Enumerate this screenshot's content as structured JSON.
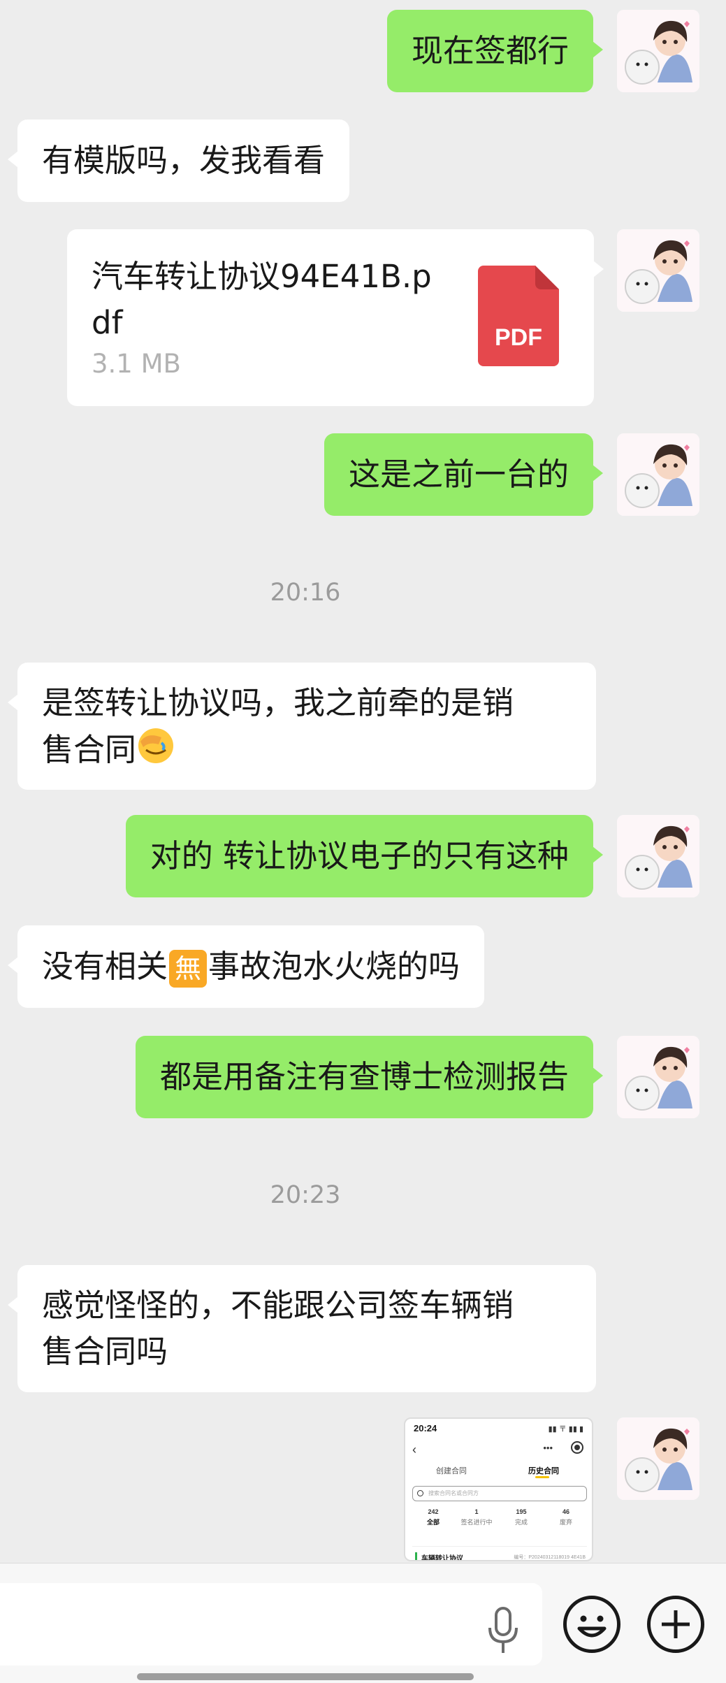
{
  "messages": [
    {
      "side": "out",
      "text": "现在签都行"
    },
    {
      "side": "in",
      "text": "有模版吗，发我看看"
    },
    {
      "side": "out",
      "type": "file",
      "file_name": "汽车转让协议94E41B.pdf",
      "file_size": "3.1 MB",
      "file_icon_label": "PDF"
    },
    {
      "side": "out",
      "text": "这是之前一台的"
    },
    {
      "time": "20:16"
    },
    {
      "side": "in",
      "text_line1": "是签转让协议吗，我之前牵的是销",
      "text_line2": "售合同",
      "emoji": "facepalm-emoji"
    },
    {
      "side": "out",
      "text": "对的 转让协议电子的只有这种"
    },
    {
      "side": "in",
      "text_before": "没有相关",
      "emoji_char": "無",
      "text_after": "事故泡水火烧的吗"
    },
    {
      "side": "out",
      "text": "都是用备注有查博士检测报告"
    },
    {
      "time": "20:23"
    },
    {
      "side": "in",
      "text_line1": "感觉怪怪的，不能跟公司签车辆销",
      "text_line2": "售合同吗"
    },
    {
      "side": "out",
      "type": "image"
    }
  ],
  "screenshot_thumb": {
    "status_time": "20:24",
    "status_right": "▮▮ 〒 ▮▮ ▮",
    "back_glyph": "‹",
    "menu_glyph": "•••",
    "tab_create": "创建合同",
    "tab_history": "历史合同",
    "search_placeholder": "搜索合同名或合同方",
    "stats": [
      {
        "num": "242",
        "label": "全部"
      },
      {
        "num": "1",
        "label": "签名进行中"
      },
      {
        "num": "195",
        "label": "完成"
      },
      {
        "num": "46",
        "label": "废弃"
      }
    ],
    "card_title": "车辆转让协议",
    "card_no": "编号：P20240312118019 4E41B"
  },
  "colors": {
    "background": "#ededed",
    "outgoing_bubble": "#95ec69",
    "incoming_bubble": "#ffffff",
    "pdf_red": "#e5484d",
    "timestamp": "#9b9b9b"
  },
  "icons": {
    "avatar": "avatar-boy-with-dog",
    "mic": "microphone-icon",
    "emoji_button": "smiley-icon",
    "more_button": "plus-icon"
  }
}
